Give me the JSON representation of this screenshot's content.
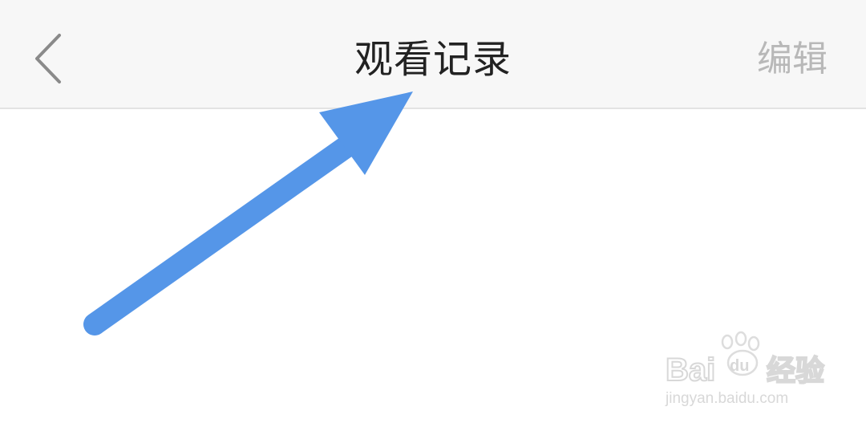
{
  "header": {
    "back_icon": "chevron-left-icon",
    "title": "观看记录",
    "edit_label": "编辑"
  },
  "annotation": {
    "arrow_color": "#5596e8"
  },
  "watermark": {
    "brand": "Baidu经验",
    "url": "jingyan.baidu.com"
  },
  "colors": {
    "navbar_bg": "#f7f7f7",
    "title_text": "#222222",
    "edit_text": "#b8b8b8",
    "divider": "#e3e3e3"
  }
}
